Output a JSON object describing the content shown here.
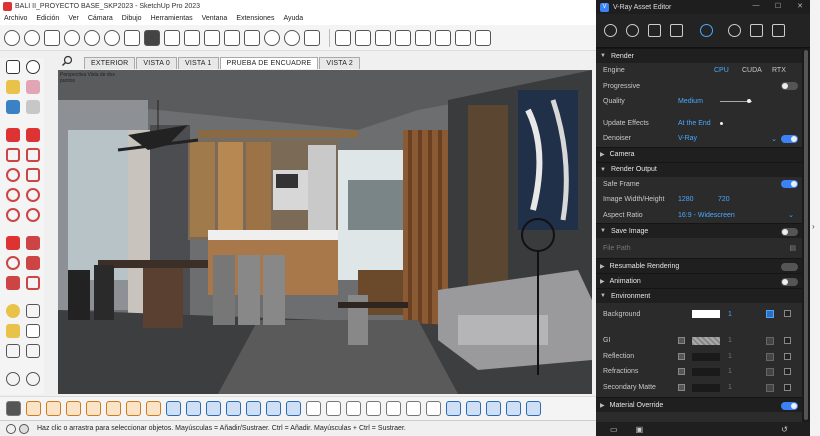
{
  "sketchup": {
    "title": "BALI II_PROYECTO BASE_SKP2023 - SketchUp Pro 2023",
    "menu": [
      "Archivo",
      "Edición",
      "Ver",
      "Cámara",
      "Dibujo",
      "Herramientas",
      "Ventana",
      "Extensiones",
      "Ayuda"
    ],
    "scene_tabs": [
      "EXTERIOR",
      "VISTA 0",
      "VISTA 1",
      "PRUEBA DE ENCUADRE",
      "VISTA 2"
    ],
    "active_tab": "PRUEBA DE ENCUADRE",
    "viewport_label": "Perspectiva\nVista de dos puntos",
    "status_text": "Haz clic o arrastra para seleccionar objetos. Mayúsculas = Añadir/Sustraer. Ctrl = Añadir. Mayúsculas + Ctrl = Sustraer."
  },
  "vray": {
    "title": "V-Ray Asset Editor",
    "sections": {
      "render": "Render",
      "camera": "Camera",
      "render_output": "Render Output",
      "save_image": "Save Image",
      "resumable": "Resumable Rendering",
      "animation": "Animation",
      "environment": "Environment",
      "material_override": "Material Override"
    },
    "engine_label": "Engine",
    "engine_options": [
      "CPU",
      "CUDA",
      "RTX"
    ],
    "progressive_label": "Progressive",
    "quality_label": "Quality",
    "quality_value": "Medium",
    "update_effects_label": "Update Effects",
    "update_effects_value": "At the End",
    "denoiser_label": "Denoiser",
    "denoiser_value": "V-Ray",
    "safe_frame_label": "Safe Frame",
    "image_wh_label": "Image Width/Height",
    "image_width": "1280",
    "image_height": "720",
    "aspect_label": "Aspect Ratio",
    "aspect_value": "16:9 - Widescreen",
    "file_path_placeholder": "File Path",
    "background_label": "Background",
    "background_value": "1",
    "env_rows": [
      {
        "label": "GI",
        "value": "1"
      },
      {
        "label": "Reflection",
        "value": "1"
      },
      {
        "label": "Refractions",
        "value": "1"
      },
      {
        "label": "Secondary Matte",
        "value": "1"
      }
    ]
  }
}
